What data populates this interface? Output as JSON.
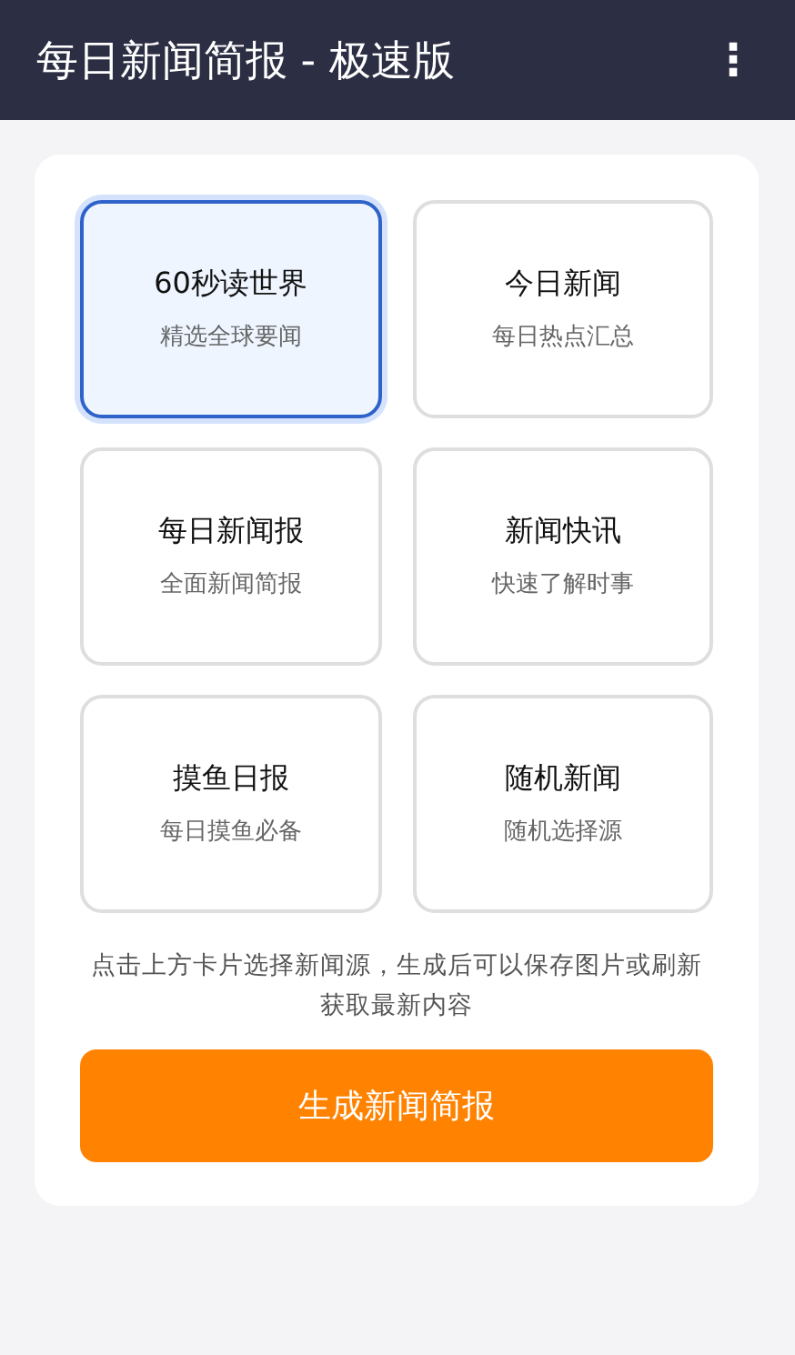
{
  "app_bar": {
    "title": "每日新闻简报 - 极速版",
    "menu_icon": "⋮"
  },
  "sources": [
    {
      "title": "60秒读世界",
      "subtitle": "精选全球要闻",
      "selected": true
    },
    {
      "title": "今日新闻",
      "subtitle": "每日热点汇总",
      "selected": false
    },
    {
      "title": "每日新闻报",
      "subtitle": "全面新闻简报",
      "selected": false
    },
    {
      "title": "新闻快讯",
      "subtitle": "快速了解时事",
      "selected": false
    },
    {
      "title": "摸鱼日报",
      "subtitle": "每日摸鱼必备",
      "selected": false
    },
    {
      "title": "随机新闻",
      "subtitle": "随机选择源",
      "selected": false
    }
  ],
  "hint": "点击上方卡片选择新闻源，生成后可以保存图片或刷新获取最新内容",
  "generate_button": "生成新闻简报"
}
